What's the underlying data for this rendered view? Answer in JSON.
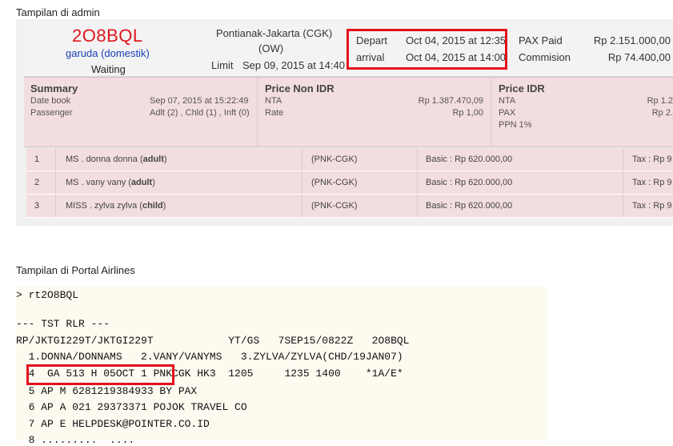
{
  "admin_section_label": "Tampilan di admin",
  "booking": {
    "code": "2O8BQL",
    "airline": "garuda (domestik)",
    "status": "Waiting",
    "route": "Pontianak-Jakarta (CGK)",
    "trip_type": "(OW)",
    "limit_label": "Limit",
    "limit_value": "Sep 09, 2015 at 14:40",
    "depart_label": "Depart",
    "depart_value": "Oct 04, 2015 at 12:35",
    "arrival_label": "arrival",
    "arrival_value": "Oct 04, 2015 at 14:00",
    "pax_paid_label": "PAX Paid",
    "pax_paid_value": "Rp 2.151.000,00",
    "commission_label": "Commision",
    "commission_value": "Rp 74.400,00"
  },
  "summary": {
    "title": "Summary",
    "date_book_label": "Date book",
    "date_book_value": "Sep 07, 2015 at 15:22:49",
    "passenger_label": "Passenger",
    "passenger_value": "Adlt (2) , Chld (1) , Inft (0)"
  },
  "price_non_idr": {
    "title": "Price Non IDR",
    "nta_label": "NTA",
    "nta_value": "Rp 1.387.470,09",
    "rate_label": "Rate",
    "rate_value": "Rp 1,00"
  },
  "price_idr": {
    "title": "Price IDR",
    "nta_label": "NTA",
    "nta_value": "Rp 1.2",
    "pax_label": "PAX",
    "pax_value": "Rp 2.",
    "ppn_label": "PPN 1%"
  },
  "passengers": [
    {
      "no": "1",
      "name_prefix": "MS . donna donna (",
      "type": "adult",
      "name_suffix": ")",
      "route": "(PNK-CGK)",
      "basic": "Basic : Rp 620.000,00",
      "tax": "Tax : Rp 9"
    },
    {
      "no": "2",
      "name_prefix": "MS . vany vany (",
      "type": "adult",
      "name_suffix": ")",
      "route": "(PNK-CGK)",
      "basic": "Basic : Rp 620.000,00",
      "tax": "Tax : Rp 9"
    },
    {
      "no": "3",
      "name_prefix": "MISS . zylva zylva (",
      "type": "child",
      "name_suffix": ")",
      "route": "(PNK-CGK)",
      "basic": "Basic : Rp 620.000,00",
      "tax": "Tax : Rp 9"
    }
  ],
  "portal_section_label": "Tampilan di Portal Airlines",
  "terminal": {
    "command": "> rt2O8BQL",
    "lines": [
      "--- TST RLR ---",
      "RP/JKTGI229T/JKTGI229T            YT/GS   7SEP15/0822Z   2O8BQL",
      "  1.DONNA/DONNAMS   2.VANY/VANYMS   3.ZYLVA/ZYLVA(CHD/19JAN07)",
      "  4  GA 513 H 05OCT 1 PNKCGK HK3  1205     1235 1400    *1A/E*",
      "  5 AP M 6281219384933 BY PAX",
      "  6 AP A 021 29373371 POJOK TRAVEL CO",
      "  7 AP E HELPDESK@POINTER.CO.ID",
      "  8 .........  ...."
    ]
  }
}
